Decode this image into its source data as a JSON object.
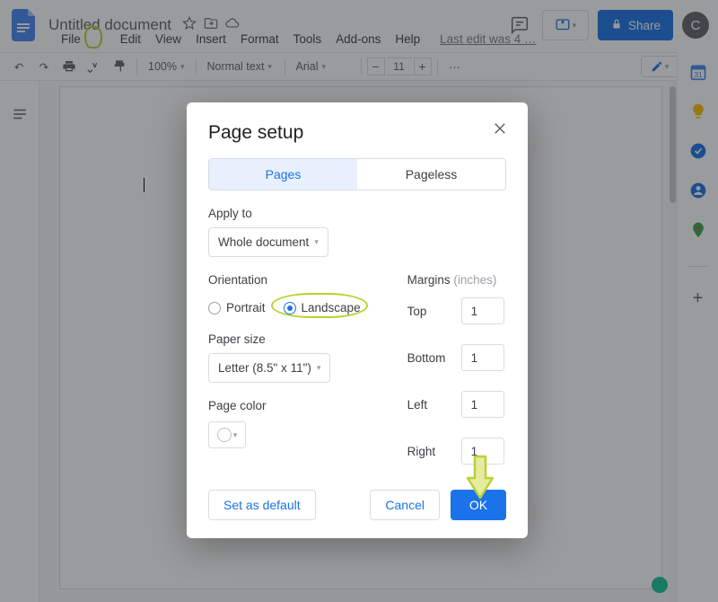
{
  "header": {
    "doc_title": "Untitled document",
    "share_label": "Share",
    "avatar_initial": "C",
    "last_edit": "Last edit was 4 …"
  },
  "menu": {
    "file": "File",
    "edit": "Edit",
    "view": "View",
    "insert": "Insert",
    "format": "Format",
    "tools": "Tools",
    "addons": "Add-ons",
    "help": "Help"
  },
  "toolbar": {
    "zoom": "100%",
    "style": "Normal text",
    "font": "Arial",
    "size": "11"
  },
  "dialog": {
    "title": "Page setup",
    "tab_pages": "Pages",
    "tab_pageless": "Pageless",
    "apply_to_label": "Apply to",
    "apply_to_value": "Whole document",
    "orientation_label": "Orientation",
    "orientation_portrait": "Portrait",
    "orientation_landscape": "Landscape",
    "paper_size_label": "Paper size",
    "paper_size_value": "Letter (8.5\" x 11\")",
    "page_color_label": "Page color",
    "margins_label": "Margins",
    "margins_unit": "(inches)",
    "margin_top": "Top",
    "margin_bottom": "Bottom",
    "margin_left": "Left",
    "margin_right": "Right",
    "margin_top_v": "1",
    "margin_bottom_v": "1",
    "margin_left_v": "1",
    "margin_right_v": "1",
    "set_default": "Set as default",
    "cancel": "Cancel",
    "ok": "OK"
  }
}
